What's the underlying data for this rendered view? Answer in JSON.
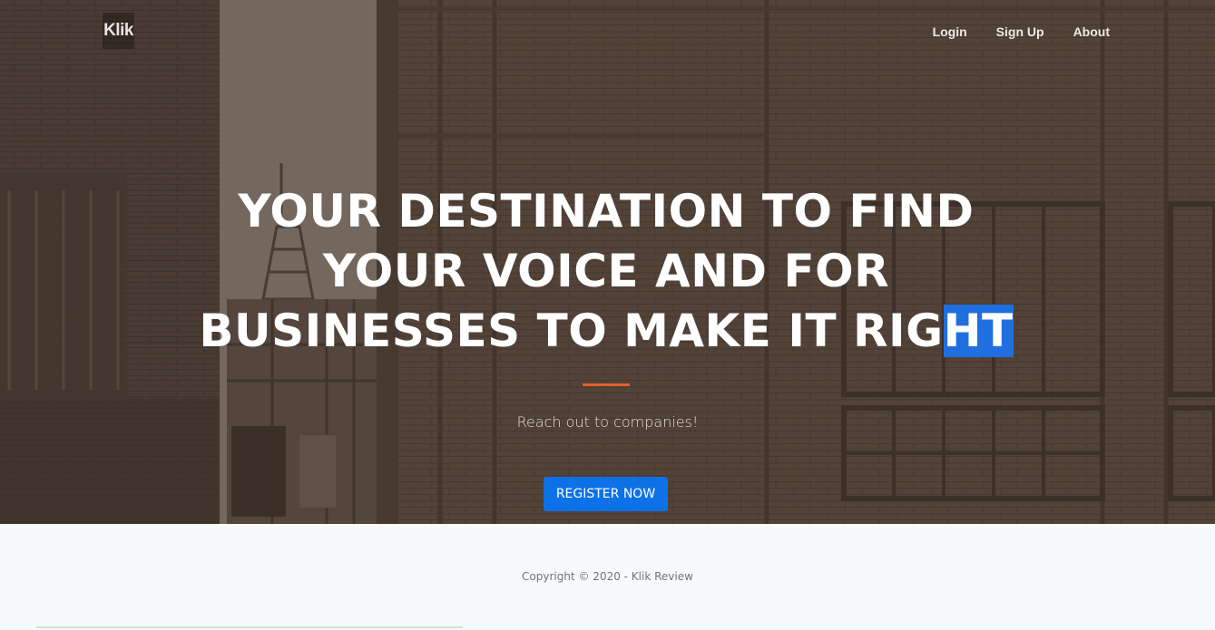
{
  "brand": {
    "logo_text": "Klik"
  },
  "nav": {
    "items": [
      {
        "label": "Login"
      },
      {
        "label": "Sign Up"
      },
      {
        "label": "About"
      }
    ]
  },
  "hero": {
    "headline_lines": [
      "YOUR DESTINATION TO FIND",
      "YOUR VOICE AND FOR",
      "BUSINESSES TO MAKE IT RIG"
    ],
    "headline_selected_text": "HT",
    "subtitle": "Reach out to companies!",
    "cta_label": "REGISTER NOW",
    "accent_color": "#e0622c",
    "cta_color": "#0d72e8",
    "background_photo": "brick-building-sepia"
  },
  "footer": {
    "copyright": "Copyright © 2020 - Klik Review"
  }
}
